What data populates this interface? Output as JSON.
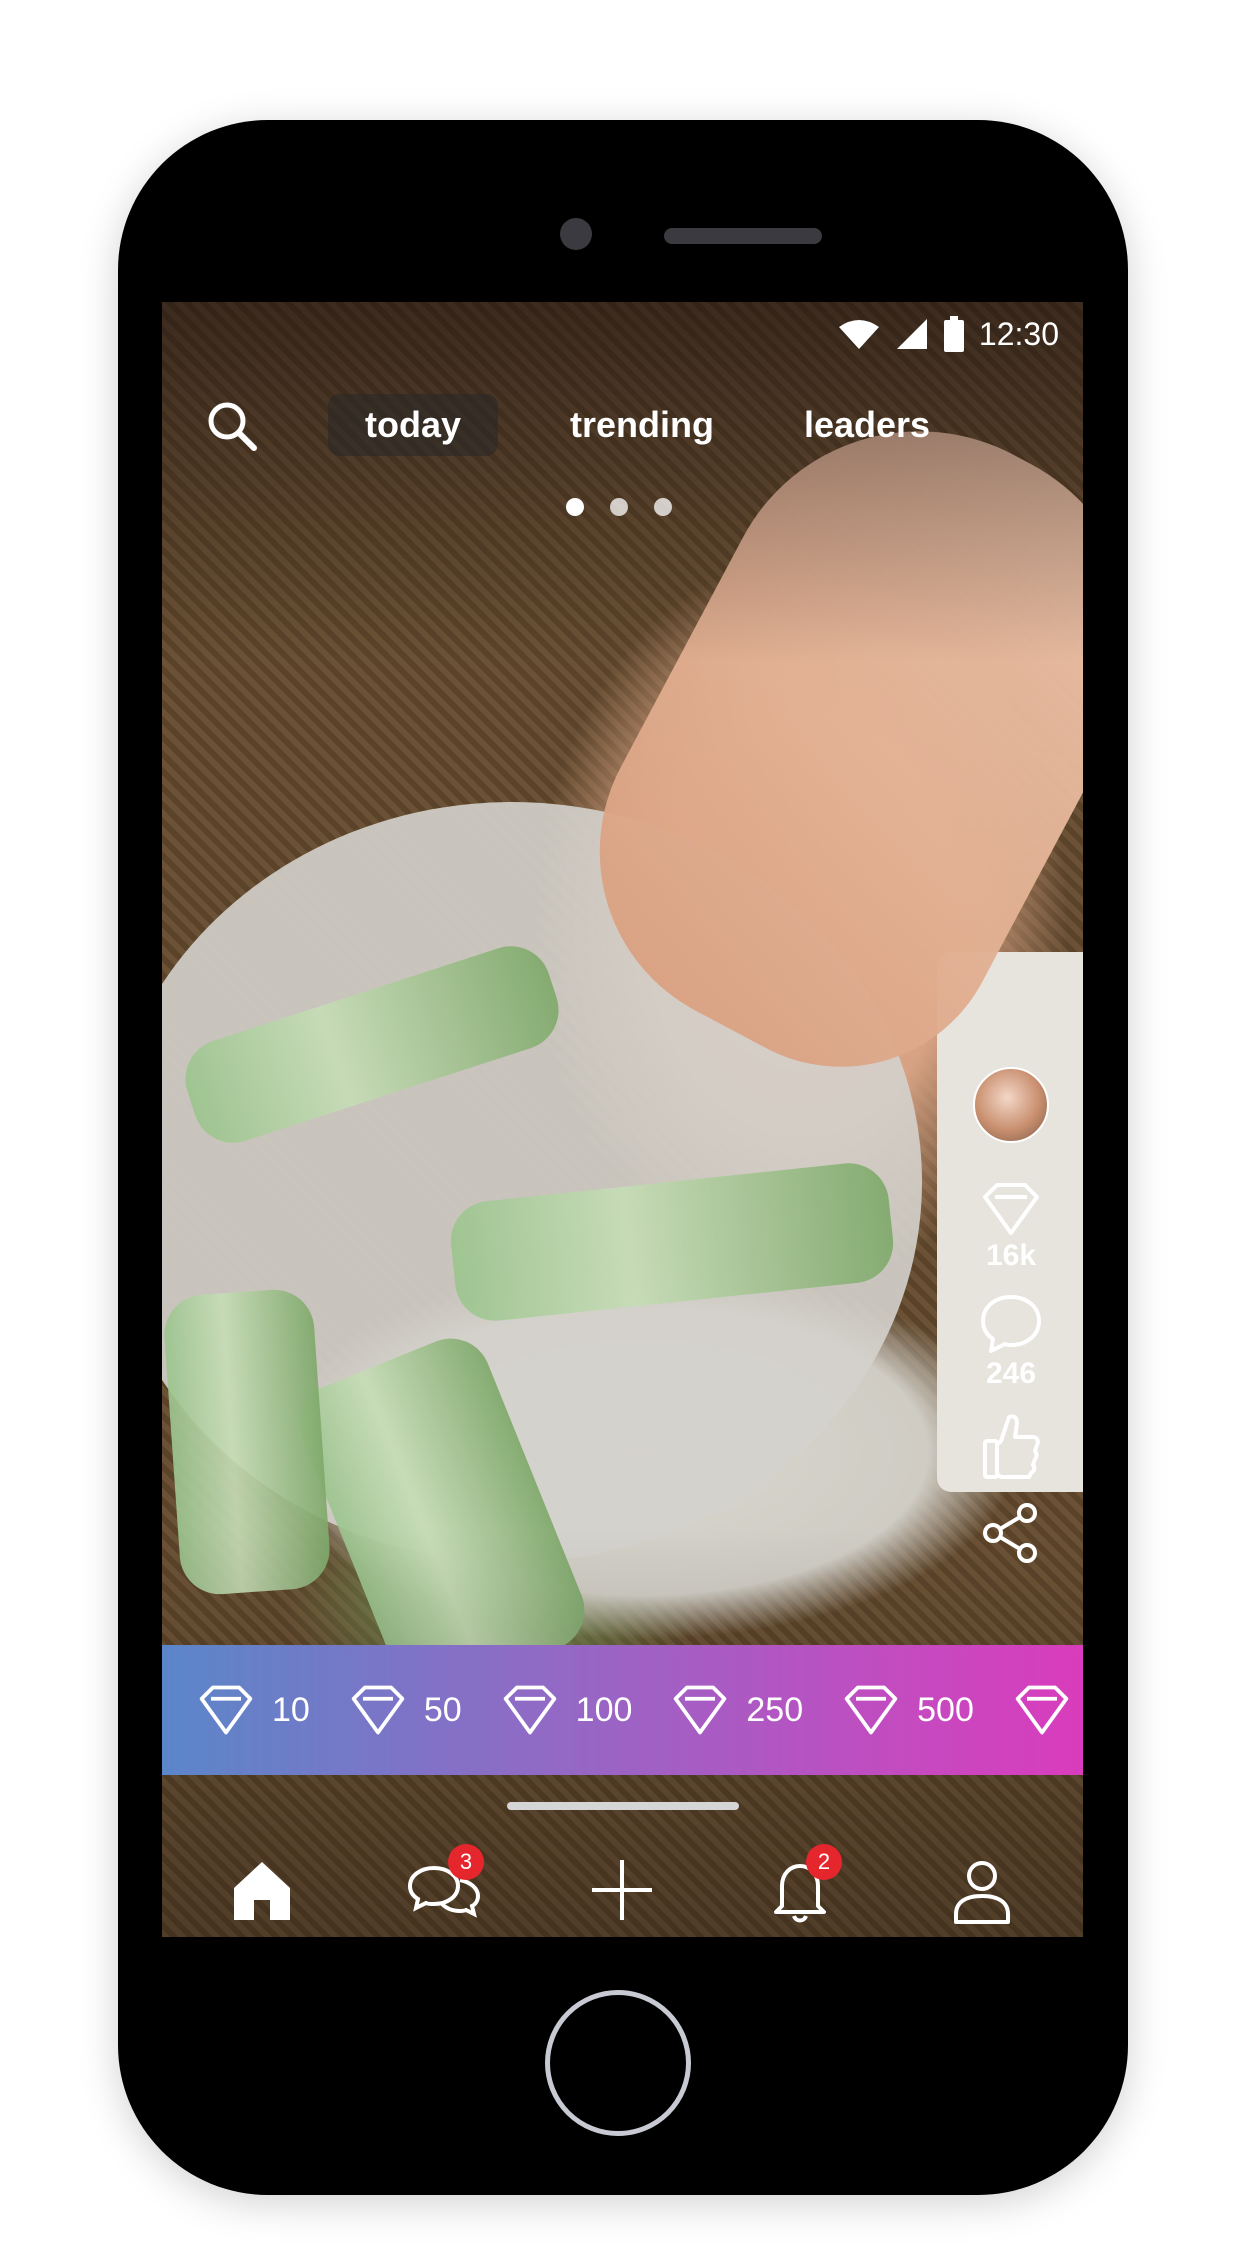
{
  "status_bar": {
    "time": "12:30",
    "icons": [
      "wifi-icon",
      "signal-icon",
      "battery-icon"
    ]
  },
  "top_nav": {
    "search_icon": "search-icon",
    "tabs": [
      {
        "label": "today",
        "active": true
      },
      {
        "label": "trending",
        "active": false
      },
      {
        "label": "leaders",
        "active": false
      }
    ],
    "page_dots": {
      "count": 3,
      "active_index": 0
    }
  },
  "side_actions": {
    "avatar": "avatar",
    "diamonds": {
      "icon": "diamond-icon",
      "count": "16k"
    },
    "comments": {
      "icon": "comment-icon",
      "count": "246"
    },
    "like": {
      "icon": "thumbs-up-icon"
    },
    "share": {
      "icon": "share-icon"
    }
  },
  "gift_bar": {
    "items": [
      {
        "icon": "diamond-icon",
        "value": "10"
      },
      {
        "icon": "diamond-icon",
        "value": "50"
      },
      {
        "icon": "diamond-icon",
        "value": "100"
      },
      {
        "icon": "diamond-icon",
        "value": "250"
      },
      {
        "icon": "diamond-icon",
        "value": "500"
      }
    ],
    "colors": {
      "start": "#5b86c9",
      "end": "#d93cbc"
    }
  },
  "bottom_nav": {
    "items": [
      {
        "icon": "home-icon",
        "active": true
      },
      {
        "icon": "chat-icon",
        "badge": "3"
      },
      {
        "icon": "plus-icon"
      },
      {
        "icon": "bell-icon",
        "badge": "2"
      },
      {
        "icon": "profile-icon"
      }
    ],
    "badge_color": "#e5262d"
  }
}
